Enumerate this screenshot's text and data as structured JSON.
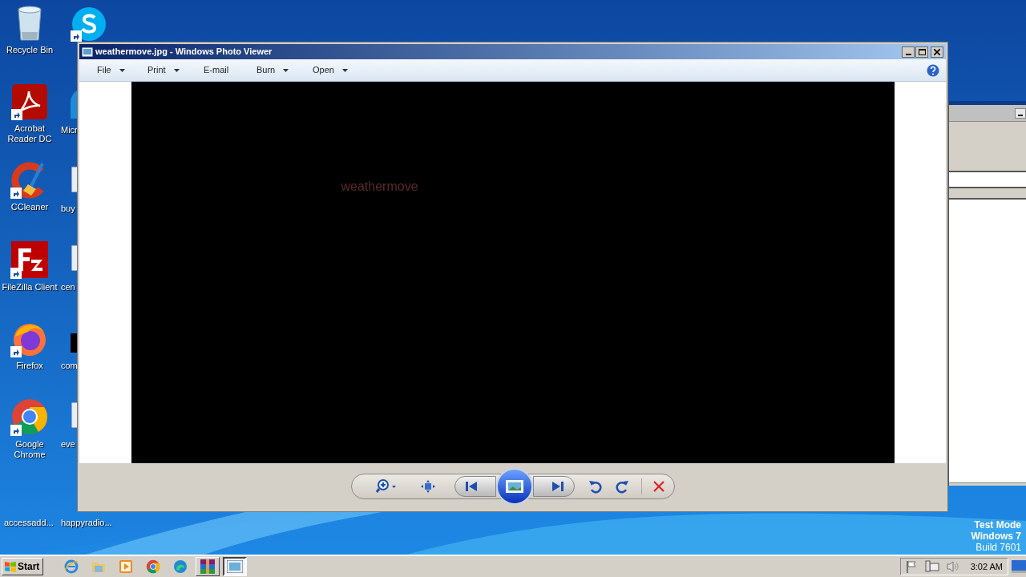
{
  "desktop_icons": [
    {
      "kind": "recycle",
      "label": "Recycle Bin"
    },
    {
      "kind": "acrobat",
      "label": "Acrobat Reader DC"
    },
    {
      "kind": "ccleaner",
      "label": "CCleaner"
    },
    {
      "kind": "filezilla",
      "label": "FileZilla Client"
    },
    {
      "kind": "firefox",
      "label": "Firefox"
    },
    {
      "kind": "chrome",
      "label": "Google Chrome"
    }
  ],
  "second_column": [
    {
      "kind": "skype"
    },
    {
      "kind": "edge",
      "label": "Micr"
    },
    {
      "kind": "doc",
      "label": "buy"
    },
    {
      "kind": "doc",
      "label": "cen"
    },
    {
      "kind": "black",
      "label": "com"
    },
    {
      "kind": "doc",
      "label": "eve"
    }
  ],
  "bottom_labels": [
    "accessadd...",
    "happyradio..."
  ],
  "window": {
    "title": "weathermove.jpg - Windows Photo Viewer",
    "menu": [
      {
        "label": "File",
        "dropdown": true
      },
      {
        "label": "Print",
        "dropdown": true
      },
      {
        "label": "E-mail",
        "dropdown": false
      },
      {
        "label": "Burn",
        "dropdown": true
      },
      {
        "label": "Open",
        "dropdown": true
      }
    ],
    "image_text": "weathermove",
    "controls": [
      {
        "kind": "zoom"
      },
      {
        "kind": "fit"
      },
      {
        "kind": "previous"
      },
      {
        "kind": "slideshow"
      },
      {
        "kind": "next"
      },
      {
        "kind": "rotate-left"
      },
      {
        "kind": "rotate-right"
      },
      {
        "kind": "delete"
      }
    ]
  },
  "watermark_lines": [
    "Test Mode",
    "Windows 7",
    "Build 7601"
  ],
  "taskbar": {
    "start": "Start",
    "apps": [
      {
        "kind": "ie",
        "active": false
      },
      {
        "kind": "explorer",
        "active": false
      },
      {
        "kind": "media",
        "active": false
      },
      {
        "kind": "chrome",
        "active": false
      },
      {
        "kind": "edge",
        "active": false
      },
      {
        "kind": "winrar",
        "active": false
      },
      {
        "kind": "photo",
        "active": true
      }
    ],
    "tray": [
      {
        "kind": "flag"
      },
      {
        "kind": "network"
      },
      {
        "kind": "volume"
      }
    ],
    "time": "3:02 AM"
  }
}
